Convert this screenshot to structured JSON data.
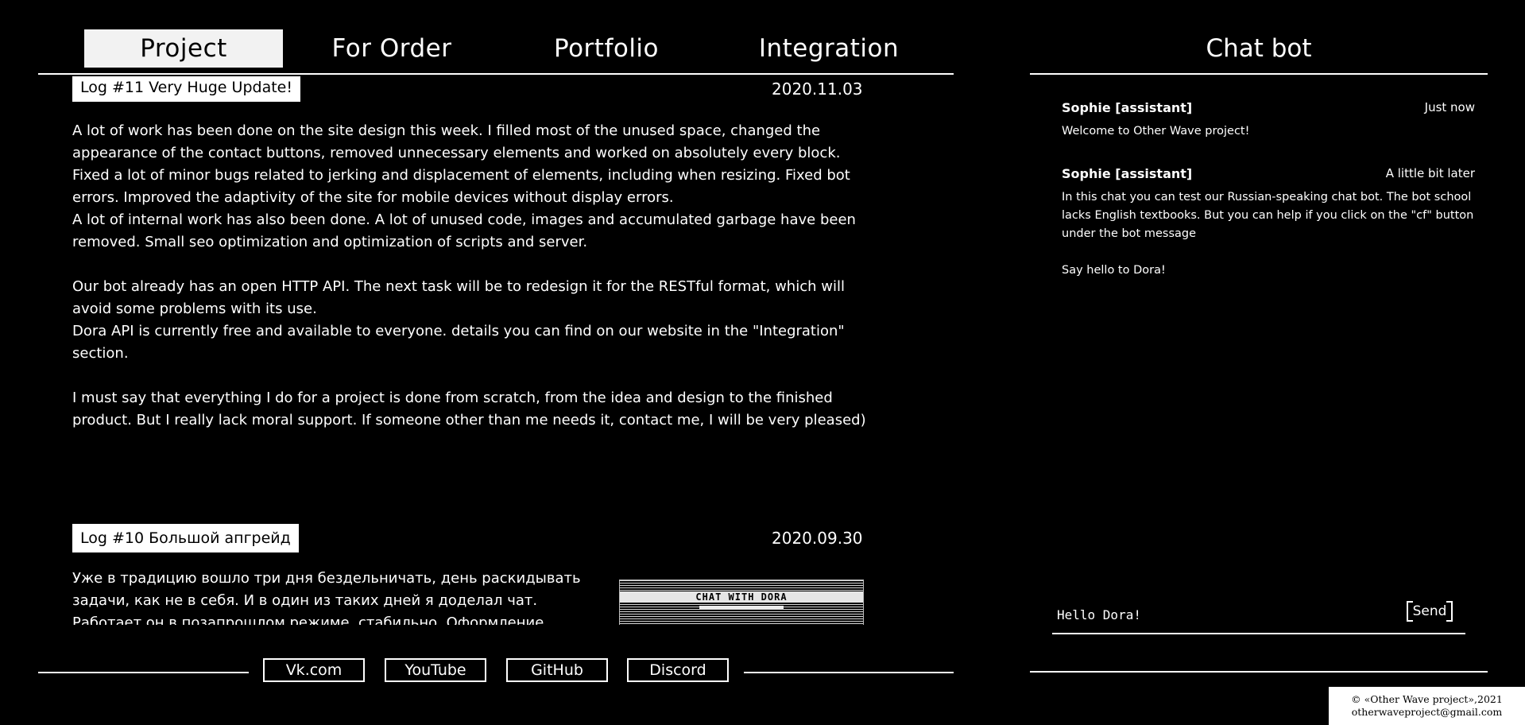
{
  "nav": {
    "items": [
      {
        "label": "Project",
        "active": true
      },
      {
        "label": "For Order",
        "active": false
      },
      {
        "label": "Portfolio",
        "active": false
      },
      {
        "label": "Integration",
        "active": false
      }
    ]
  },
  "posts": [
    {
      "title": "Log #11 Very Huge Update!",
      "date": "2020.11.03",
      "paragraphs": [
        "A lot of work has been done on the site design this week. I filled most of the unused space, changed the appearance of the contact buttons, removed unnecessary elements and worked on absolutely every block.\nFixed a lot of minor bugs related to jerking and displacement of elements, including when resizing. Fixed bot errors. Improved the adaptivity of the site for mobile devices without display errors.\nA lot of internal work has also been done. A lot of unused code, images and accumulated garbage have been removed. Small seo optimization and optimization of scripts and server.",
        "Our bot already has an open HTTP API. The next task will be to redesign it for the RESTful format, which will avoid some problems with its use.\nDora API is currently free and available to everyone. details you can find on our website in the \"Integration\" section.",
        "I must say that everything I do for a project is done from scratch, from the idea and design to the finished product. But I really lack moral support. If someone other than me needs it, contact me, I will be very pleased)"
      ]
    },
    {
      "title": "Log #10 Большой апгрейд",
      "date": "2020.09.30",
      "text": "Уже в традицию вошло три дня бездельничать, день раскидывать задачи, как не в себя. И в один из таких дней я доделал чат. Работает он в позапрошлом режиме, стабильно. Оформление описанное будет",
      "image_label": "CHAT WITH DORA"
    }
  ],
  "contacts": [
    "Vk.com",
    "YouTube",
    "GitHub",
    "Discord"
  ],
  "chat": {
    "title": "Chat bot",
    "messages": [
      {
        "author": "Sophie [assistant]",
        "time": "Just now",
        "text": "Welcome to Other Wave project!"
      },
      {
        "author": "Sophie [assistant]",
        "time": "A little bit later",
        "text": "In this chat you can test our Russian-speaking chat bot. The bot school lacks English textbooks. But you can help if you click on the \"cf\" button under the bot message\n\nSay hello to Dora!"
      }
    ],
    "input_value": "Hello Dora!",
    "send_label": "Send"
  },
  "footer": {
    "copyright": "© «Other Wave project»,2021",
    "email": "otherwaveproject@gmail.com"
  },
  "colors": {
    "background": "#000000",
    "foreground": "#ffffff",
    "active_tab_bg": "#f2f2f2"
  }
}
